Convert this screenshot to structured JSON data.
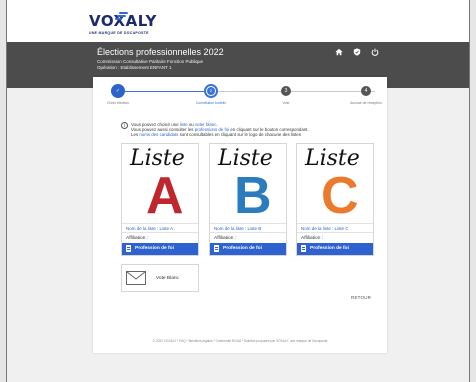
{
  "brand": {
    "name": "VOXALY",
    "tagline": "UNE MARQUE DE DOCAPOSTE"
  },
  "header": {
    "title": "Élections professionnelles 2022",
    "subtitle_1": "Commission Consultative Paritaire Fonction Publique",
    "subtitle_2": "Opération : Etablissement ENFANT 1",
    "icons": [
      "home-icon",
      "shield-icon",
      "power-icon"
    ]
  },
  "stepper": {
    "steps": [
      {
        "label": "Choix élection",
        "number": "✓",
        "state": "done"
      },
      {
        "label": "Constitution bulletin",
        "number": "2",
        "state": "current"
      },
      {
        "label": "Vote",
        "number": "3",
        "state": "todo"
      },
      {
        "label": "Accusé de réception",
        "number": "4",
        "state": "todo"
      }
    ]
  },
  "info": {
    "line1_pre": "Vous pouvez choisir une ",
    "line1_link1": "liste",
    "line1_mid": " ou ",
    "line1_link2": "voter blanc",
    "line1_post": ".",
    "line2_pre": "Vous pouvez aussi consulter les ",
    "line2_link": "professions de foi",
    "line2_post": " en cliquant sur le bouton correspondant.",
    "line3_pre": "Les ",
    "line3_link": "noms des candidats",
    "line3_post": " sont consultables en cliquant sur le logo de chacune des listes"
  },
  "lists": [
    {
      "script": "Liste",
      "letter": "A",
      "color": "#c0262d",
      "name": "Nom de la liste : Liste A",
      "affiliation": "Affiliation :",
      "button": "Profession de foi"
    },
    {
      "script": "Liste",
      "letter": "B",
      "color": "#2b7bbf",
      "name": "Nom de la liste : Liste B",
      "affiliation": "Affiliation :",
      "button": "Profession de foi"
    },
    {
      "script": "Liste",
      "letter": "C",
      "color": "#ec7a2c",
      "name": "Nom de la liste : Liste C",
      "affiliation": "Affiliation :",
      "button": "Profession de foi"
    }
  ],
  "blank_vote": {
    "label": "Vote Blanc"
  },
  "retour": "RETOUR",
  "footer": "© 2022 VOXALY * FAQ * Mentions légales * Conformité RGAA * Solution proposée par VOXALY, une marque de Docaposte",
  "colors": {
    "accent": "#2f62d1",
    "header_bg": "#4c4c4c",
    "brand": "#1d2a6e"
  }
}
